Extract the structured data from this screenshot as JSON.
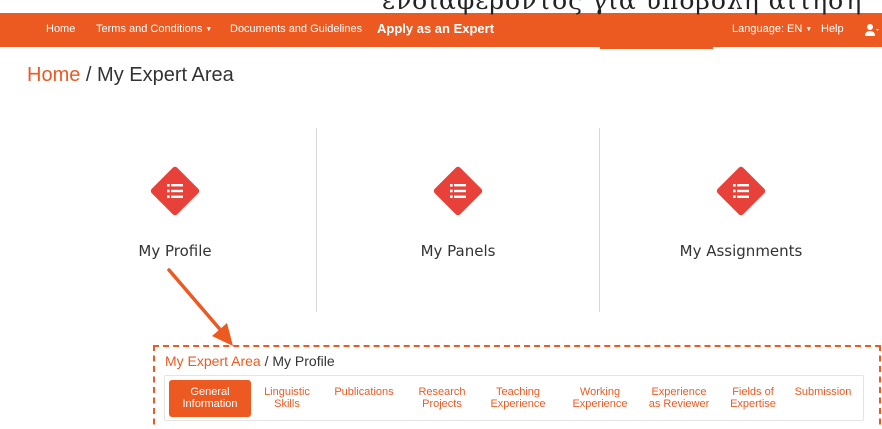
{
  "overlay_text": "ενδιαφέροντος για υποβολή αιτηση",
  "navbar": {
    "items": [
      {
        "label": "Home"
      },
      {
        "label": "Terms and Conditions",
        "caret": "▼"
      },
      {
        "label": "Documents and Guidelines"
      },
      {
        "label": "Apply as an Expert"
      },
      {
        "label": "Language: EN",
        "caret": "▼"
      },
      {
        "label": "Help"
      }
    ],
    "user_caret": "▼"
  },
  "breadcrumb": {
    "link": "Home",
    "separator": " / ",
    "current": "My Expert Area"
  },
  "tiles": [
    {
      "label": "My Profile",
      "icon": "list-icon"
    },
    {
      "label": "My Panels",
      "icon": "list-icon"
    },
    {
      "label": "My Assignments",
      "icon": "list-icon"
    }
  ],
  "profile_breadcrumb": {
    "link": "My Expert Area",
    "separator": " / ",
    "current": "My Profile"
  },
  "tabs": [
    {
      "line1": "General",
      "line2": "Information",
      "active": true
    },
    {
      "line1": "Linguistic",
      "line2": "Skills"
    },
    {
      "line1": "Publications",
      "line2": ""
    },
    {
      "line1": "Research",
      "line2": "Projects"
    },
    {
      "line1": "Teaching",
      "line2": "Experience"
    },
    {
      "line1": "Working",
      "line2": "Experience"
    },
    {
      "line1": "Experience",
      "line2": "as Reviewer"
    },
    {
      "line1": "Fields of",
      "line2": "Expertise"
    },
    {
      "line1": "Submission",
      "line2": ""
    }
  ],
  "colors": {
    "accent": "#ec5a22",
    "icon_red": "#e8413a",
    "text": "#333333"
  }
}
